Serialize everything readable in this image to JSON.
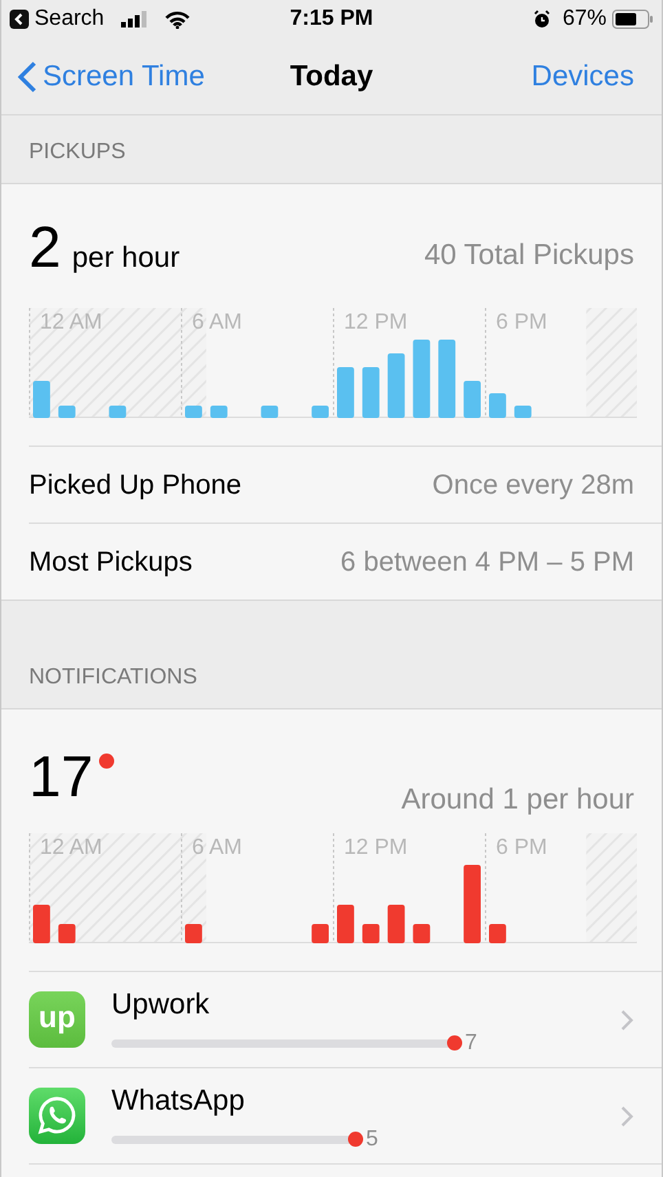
{
  "status_bar": {
    "back_label": "Search",
    "time": "7:15 PM",
    "battery": "67%"
  },
  "nav": {
    "back": "Screen Time",
    "title": "Today",
    "action": "Devices"
  },
  "pickups": {
    "header": "PICKUPS",
    "value": "2",
    "unit": "per hour",
    "total": "40 Total Pickups",
    "time_labels": [
      "12 AM",
      "6 AM",
      "12 PM",
      "6 PM"
    ],
    "rows": [
      {
        "label": "Picked Up Phone",
        "value": "Once every 28m"
      },
      {
        "label": "Most Pickups",
        "value": "6 between 4 PM – 5 PM"
      }
    ]
  },
  "notifications": {
    "header": "NOTIFICATIONS",
    "value": "17",
    "rate": "Around 1 per hour",
    "time_labels": [
      "12 AM",
      "6 AM",
      "12 PM",
      "6 PM"
    ],
    "apps": [
      {
        "name": "Upwork",
        "logo_text": "up",
        "count": "7"
      },
      {
        "name": "WhatsApp",
        "count": "5"
      }
    ]
  }
}
